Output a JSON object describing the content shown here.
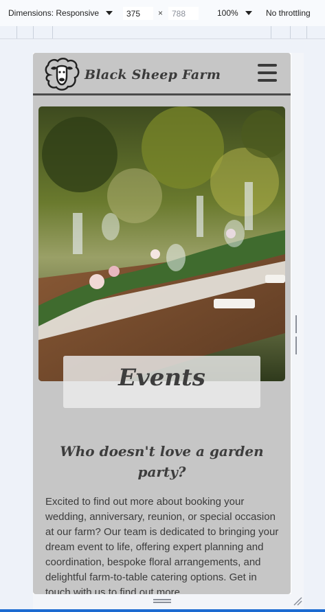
{
  "devtools": {
    "dimensions_label": "Dimensions: Responsive",
    "width_value": "375",
    "height_placeholder": "788",
    "times_symbol": "×",
    "zoom_label": "100%",
    "throttle_label": "No throttling"
  },
  "site": {
    "brand": "Black Sheep Farm",
    "hero_title": "Events",
    "subheading": "Who doesn't love a garden party?",
    "body": "Excited to find out more about booking your wedding, anniversary, reunion, or special occasion at our farm? Our team is dedicated to bringing your dream event to life, offering expert planning and coordination, bespoke floral arrangements, and delightful farm-to-table catering options. Get in touch with us to find out more."
  },
  "colors": {
    "accent_blue": "#1c6bd1",
    "page_gray": "#c6c6c6",
    "header_rule": "#4a4a4a"
  }
}
